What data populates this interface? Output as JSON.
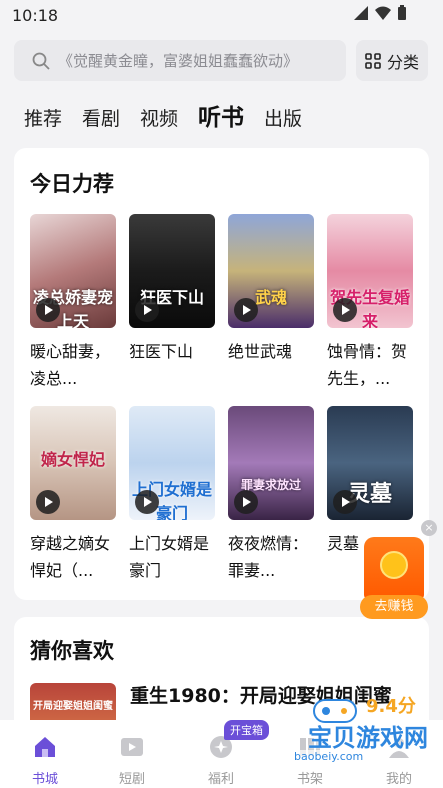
{
  "status_bar": {
    "time": "10:18"
  },
  "search": {
    "placeholder": "《觉醒黄金瞳，富婆姐姐蠢蠢欲动》"
  },
  "category_button": {
    "label": "分类"
  },
  "tabs": [
    {
      "label": "推荐",
      "active": false
    },
    {
      "label": "看剧",
      "active": false
    },
    {
      "label": "视频",
      "active": false
    },
    {
      "label": "听书",
      "active": true
    },
    {
      "label": "出版",
      "active": false
    }
  ],
  "today_picks": {
    "title": "今日力荐",
    "books": [
      {
        "title": "暖心甜妻，凌总...",
        "cover_text": "凌总娇妻宠上天"
      },
      {
        "title": "狂医下山",
        "cover_text": "狂医下山"
      },
      {
        "title": "绝世武魂",
        "cover_text": "武魂"
      },
      {
        "title": "蚀骨情：贺先生，...",
        "cover_text": "贺先生复婚来"
      },
      {
        "title": "穿越之嫡女悍妃（...",
        "cover_text": "嫡女悍妃"
      },
      {
        "title": "上门女婿是豪门",
        "cover_text": "上门女婿是豪门"
      },
      {
        "title": "夜夜燃情：罪妻...",
        "cover_text": "罪妻求放过"
      },
      {
        "title": "灵墓",
        "cover_text": "灵墓"
      }
    ]
  },
  "guess_you_like": {
    "title": "猜你喜欢",
    "item": {
      "title": "重生1980：开局迎娶姐姐闺蜜",
      "cover_text": "开局迎娶姐姐闺蜜"
    }
  },
  "float_widget": {
    "label": "去赚钱",
    "close": "×"
  },
  "bottom_nav": [
    {
      "label": "书城",
      "icon": "home-icon",
      "active": true
    },
    {
      "label": "短剧",
      "icon": "play-icon",
      "active": false
    },
    {
      "label": "福利",
      "icon": "gift-icon",
      "active": false
    },
    {
      "label": "书架",
      "icon": "bookshelf-icon",
      "active": false
    },
    {
      "label": "我的",
      "icon": "profile-icon",
      "active": false
    }
  ],
  "welfare_badge": "开宝箱",
  "watermark": {
    "score": "9.4分",
    "name": "宝贝游戏网",
    "url": "baobeiy.com"
  },
  "colors": {
    "accent": "#6b4fd8",
    "orange": "#ff6a00",
    "background": "#f3f3f5"
  }
}
